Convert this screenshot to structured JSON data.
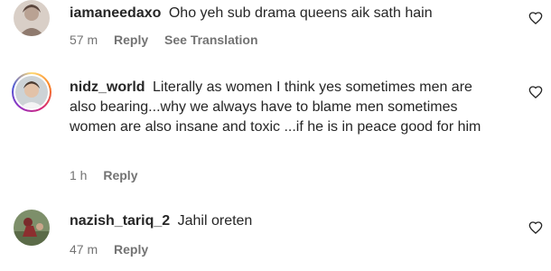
{
  "comments": [
    {
      "username": "iamaneedaxo",
      "text": "Oho yeh sub drama queens aik sath hain",
      "time": "57 m",
      "reply": "Reply",
      "translation": "See Translation",
      "like_icon": "heart-outline-icon"
    },
    {
      "username": "nidz_world",
      "text": "Literally as women I think yes sometimes men are also bearing...why we always have to blame men sometimes women are also insane and toxic ...if he is in peace good for him",
      "time": "1 h",
      "reply": "Reply",
      "like_icon": "heart-outline-icon"
    },
    {
      "username": "nazish_tariq_2",
      "text": "Jahil oreten",
      "time": "47 m",
      "reply": "Reply",
      "like_icon": "heart-outline-icon"
    }
  ]
}
